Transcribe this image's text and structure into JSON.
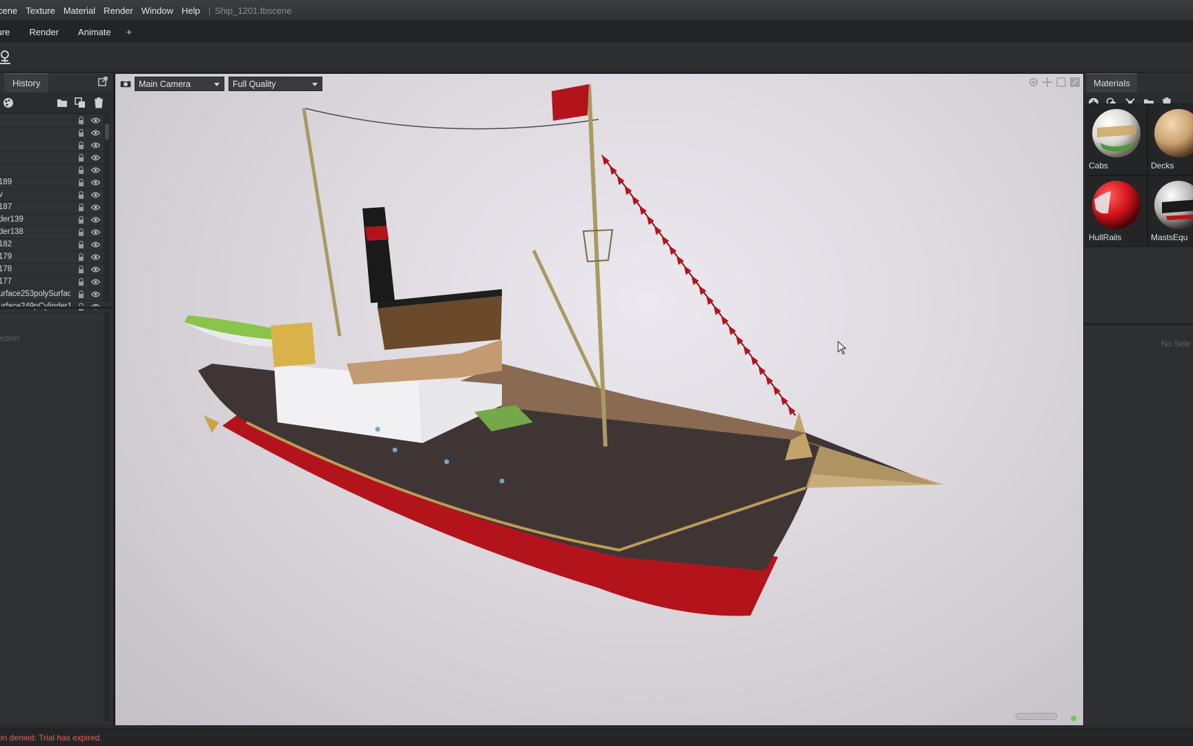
{
  "menubar": {
    "items": [
      "cene",
      "Texture",
      "Material",
      "Render",
      "Window",
      "Help"
    ],
    "separator": "|",
    "document": "Ship_1201.tbscene"
  },
  "rooms": {
    "items": [
      "ture",
      "Render",
      "Animate"
    ],
    "add_label": "+"
  },
  "left_panel": {
    "tab_label": "History",
    "objects": [
      {
        "name": ""
      },
      {
        "name": ""
      },
      {
        "name": ""
      },
      {
        "name": ""
      },
      {
        "name": ""
      },
      {
        "name": "189"
      },
      {
        "name": "v"
      },
      {
        "name": "187"
      },
      {
        "name": "der139"
      },
      {
        "name": "der138"
      },
      {
        "name": "182"
      },
      {
        "name": "179"
      },
      {
        "name": "178"
      },
      {
        "name": "177"
      },
      {
        "name": "urface253polySurfac"
      },
      {
        "name": "urface249pCylinder1"
      }
    ],
    "selection_label": "ection"
  },
  "viewport": {
    "camera": "Main Camera",
    "quality": "Full Quality"
  },
  "materials_panel": {
    "tab_label": "Materials",
    "materials": [
      {
        "name": "Cabs"
      },
      {
        "name": "Decks"
      },
      {
        "name": "HullRails"
      },
      {
        "name": "MastsEqu"
      }
    ],
    "no_selection": "No Sele"
  },
  "status": {
    "message": "on denied: Trial has expired."
  },
  "colors": {
    "hull_red": "#b3141c",
    "hull_dark": "#3f3535",
    "status_error": "#e2635b",
    "viewport_bg": "#e3dfe6"
  }
}
